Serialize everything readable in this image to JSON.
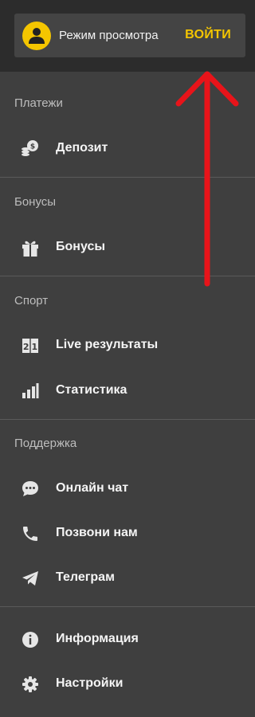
{
  "header": {
    "mode_label": "Режим просмотра",
    "login_label": "ВОЙТИ",
    "accent_color": "#f4c500"
  },
  "sections": {
    "payments": {
      "title": "Платежи",
      "items": [
        {
          "label": "Депозит",
          "icon": "coins-icon"
        }
      ]
    },
    "bonuses": {
      "title": "Бонусы",
      "items": [
        {
          "label": "Бонусы",
          "icon": "gift-icon"
        }
      ]
    },
    "sport": {
      "title": "Спорт",
      "items": [
        {
          "label": "Live результаты",
          "icon": "scoreboard-icon"
        },
        {
          "label": "Статистика",
          "icon": "bar-chart-icon"
        }
      ]
    },
    "support": {
      "title": "Поддержка",
      "items": [
        {
          "label": "Онлайн чат",
          "icon": "chat-icon"
        },
        {
          "label": "Позвони нам",
          "icon": "phone-icon"
        },
        {
          "label": "Телеграм",
          "icon": "telegram-icon"
        }
      ]
    },
    "misc": {
      "items": [
        {
          "label": "Информация",
          "icon": "info-icon"
        },
        {
          "label": "Настройки",
          "icon": "gear-icon"
        }
      ]
    }
  },
  "annotation_color": "#e8141a"
}
